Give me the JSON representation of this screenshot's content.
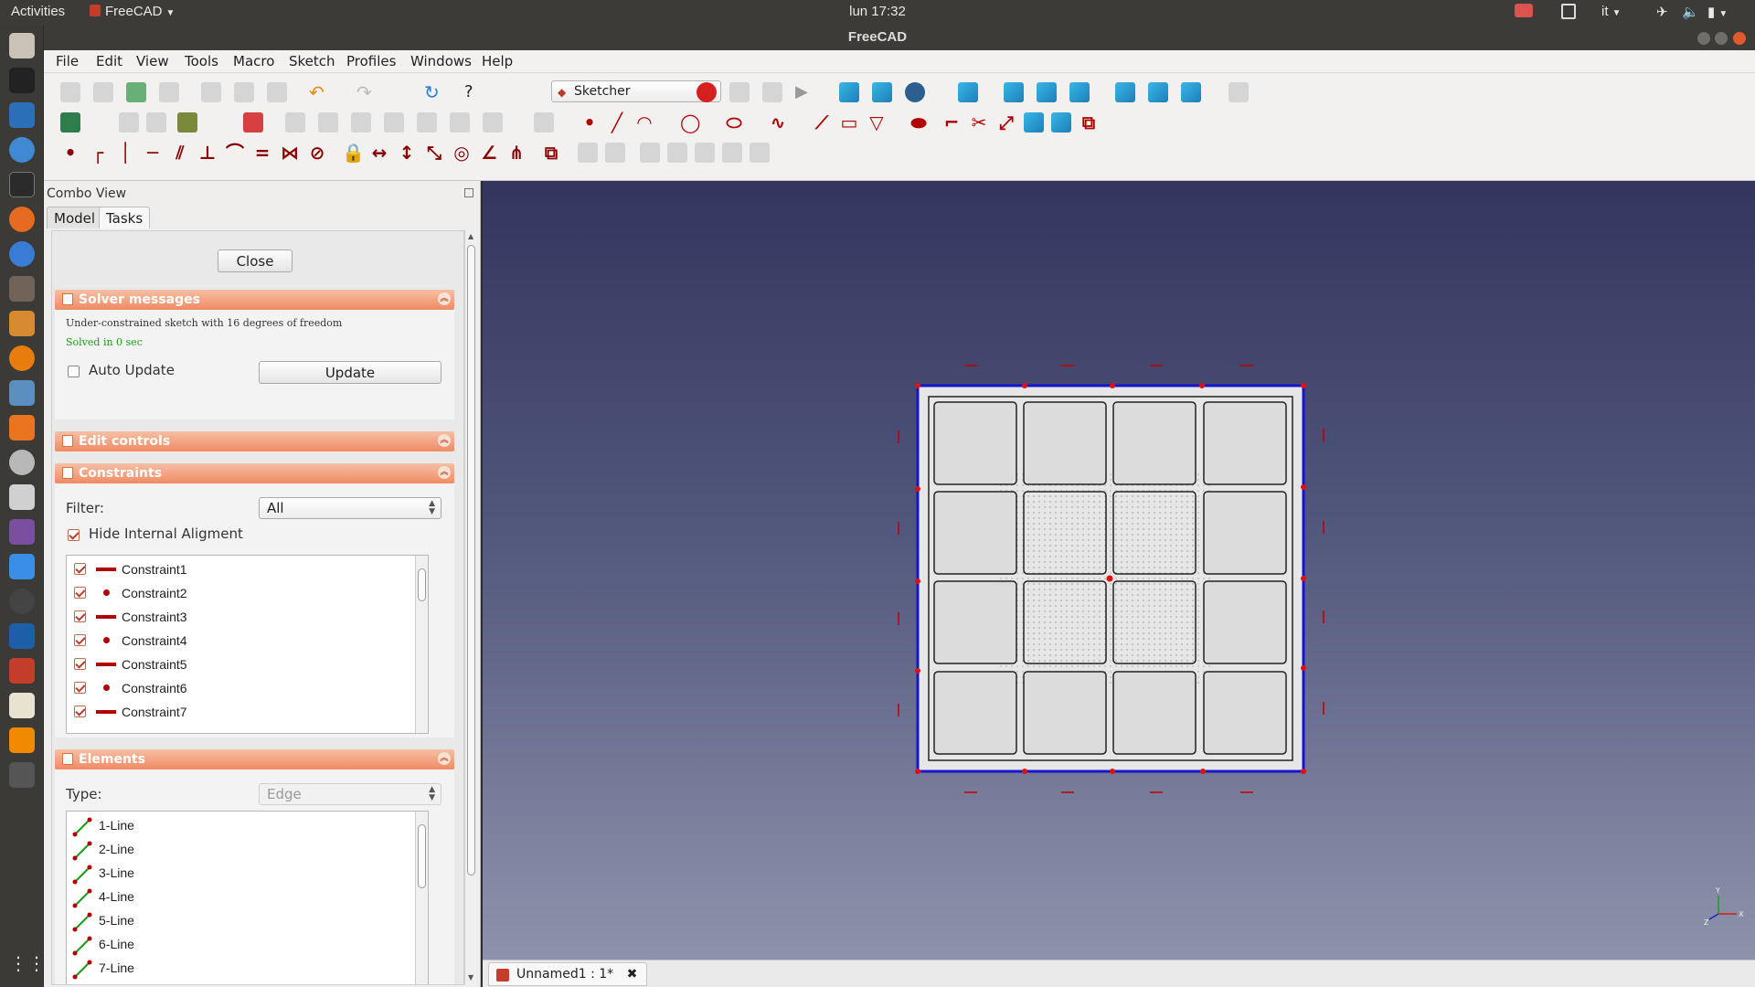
{
  "topbar": {
    "activities": "Activities",
    "app_name": "FreeCAD",
    "clock": "lun 17:32",
    "lang": "it"
  },
  "window": {
    "title": "FreeCAD"
  },
  "menubar": [
    "File",
    "Edit",
    "View",
    "Tools",
    "Macro",
    "Sketch",
    "Profiles",
    "Windows",
    "Help"
  ],
  "toolbar": {
    "workbench": "Sketcher"
  },
  "combo": {
    "title": "Combo View",
    "tabs": [
      "Model",
      "Tasks"
    ],
    "close_label": "Close",
    "solver": {
      "header": "Solver messages",
      "msg1": "Under-constrained sketch with 16 degrees of freedom",
      "msg2": "Solved in 0 sec",
      "auto_update": "Auto Update",
      "update_label": "Update"
    },
    "edit_controls": {
      "header": "Edit controls"
    },
    "constraints": {
      "header": "Constraints",
      "filter_label": "Filter:",
      "filter_value": "All",
      "hide_internal": "Hide Internal Aligment",
      "items": [
        {
          "name": "Constraint1",
          "icon": "horizontal-icon"
        },
        {
          "name": "Constraint2",
          "icon": "coincident-icon"
        },
        {
          "name": "Constraint3",
          "icon": "horizontal-icon"
        },
        {
          "name": "Constraint4",
          "icon": "coincident-icon"
        },
        {
          "name": "Constraint5",
          "icon": "horizontal-icon"
        },
        {
          "name": "Constraint6",
          "icon": "coincident-icon"
        },
        {
          "name": "Constraint7",
          "icon": "horizontal-icon"
        }
      ]
    },
    "elements": {
      "header": "Elements",
      "type_label": "Type:",
      "type_value": "Edge",
      "items": [
        "1-Line",
        "2-Line",
        "3-Line",
        "4-Line",
        "5-Line",
        "6-Line",
        "7-Line"
      ]
    }
  },
  "document": {
    "tab_label": "Unnamed1 : 1*"
  },
  "colors": {
    "panel_header": "#f08a62",
    "sketch_edge": "#1515d0",
    "constraint_red": "#b00000",
    "view_bg_top": "#33355e",
    "view_bg_bottom": "#8e93ac"
  }
}
